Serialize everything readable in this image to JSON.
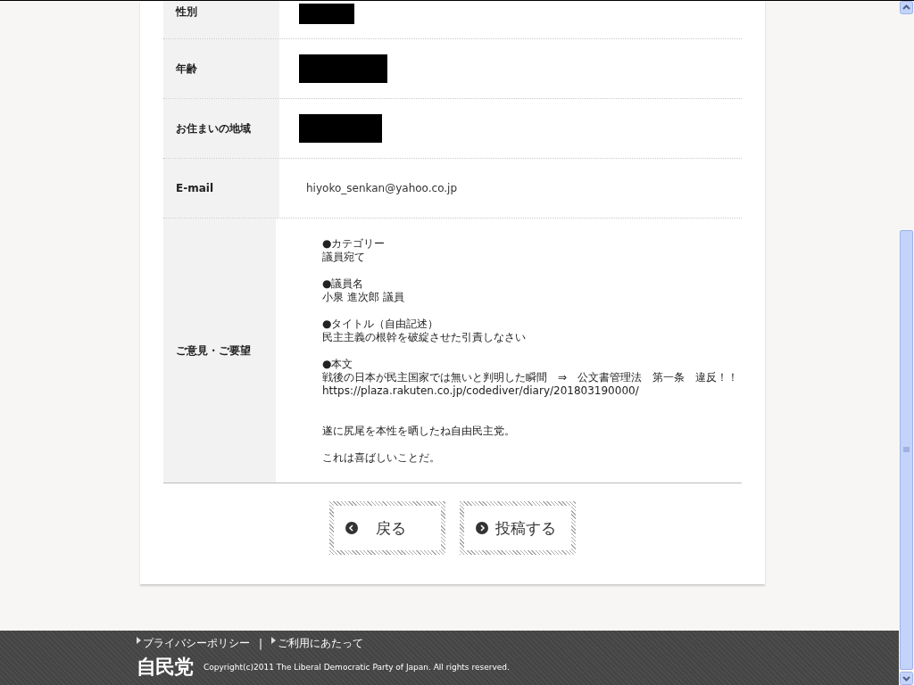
{
  "form_rows": [
    {
      "label": "性別",
      "kind": "redacted"
    },
    {
      "label": "年齢",
      "kind": "redacted"
    },
    {
      "label": "お住まいの地域",
      "kind": "redacted"
    },
    {
      "label": "E-mail",
      "kind": "text",
      "value": "hiyoko_senkan@yahoo.co.jp"
    },
    {
      "label": "ご意見・ご要望",
      "kind": "message",
      "paragraphs": [
        [
          "●カテゴリー",
          "議員宛て"
        ],
        [
          "●議員名",
          "小泉 進次郎 議員"
        ],
        [
          "●タイトル（自由記述）",
          "民主主義の根幹を破綻させた引責しなさい"
        ],
        [
          "●本文",
          "戦後の日本が民主国家では無いと判明した瞬間　⇒　公文書管理法　第一条　違反！！",
          "https://plaza.rakuten.co.jp/codediver/diary/201803190000/"
        ],
        [
          "遂に尻尾を本性を晒したね自由民主党。"
        ],
        [
          "これは喜ばしいことだ。"
        ]
      ]
    }
  ],
  "buttons": [
    {
      "label": "戻る",
      "kind": "back"
    },
    {
      "label": "投稿する",
      "kind": "submit"
    }
  ],
  "footer": {
    "links": [
      "プライバシーポリシー",
      "ご利用にあたって"
    ],
    "separator": "|",
    "logo": "自民党",
    "copyright": "Copyright(c)2011 The Liberal Democratic Party of Japan. All rights reserved."
  }
}
